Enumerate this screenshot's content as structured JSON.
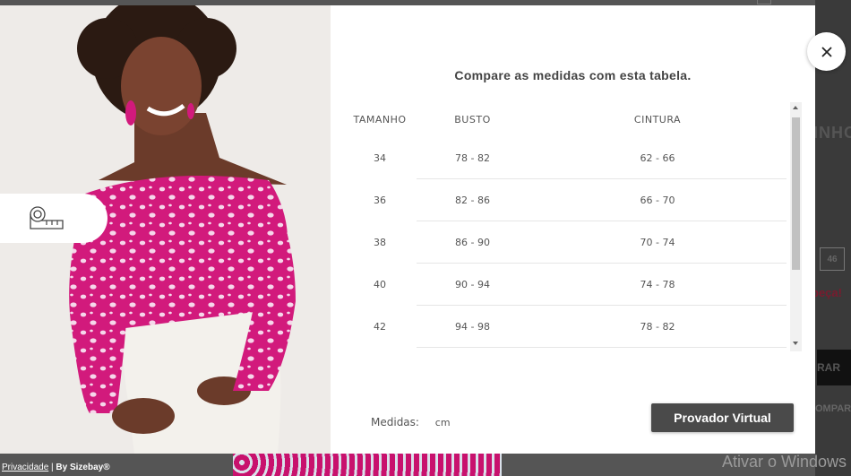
{
  "background": {
    "product_title_fragment": "INHO",
    "size_box": "46",
    "warning_fragment": "peça!",
    "button_fragment": "RAR",
    "compare_fragment": "OMPAR"
  },
  "footer": {
    "privacy_link": "Privacidade",
    "separator": " | ",
    "by": "By Sizebay®"
  },
  "watermark": "Ativar o Windows",
  "modal": {
    "heading": "Compare as medidas com esta tabela.",
    "table": {
      "headers": [
        "TAMANHO",
        "BUSTO",
        "CINTURA"
      ],
      "rows": [
        [
          "34",
          "78 - 82",
          "62 - 66"
        ],
        [
          "36",
          "82 - 86",
          "66 - 70"
        ],
        [
          "38",
          "86 - 90",
          "70 - 74"
        ],
        [
          "40",
          "90 - 94",
          "74 - 78"
        ],
        [
          "42",
          "94 - 98",
          "78 - 82"
        ]
      ]
    },
    "units_label": "Medidas:",
    "units_value": "cm",
    "virtual_button": "Provador Virtual"
  },
  "colors": {
    "blouse": "#d21a7c",
    "button": "#4a4a4a"
  },
  "icons": {
    "close": "close-icon",
    "measuring_tape": "measuring-tape-icon"
  }
}
